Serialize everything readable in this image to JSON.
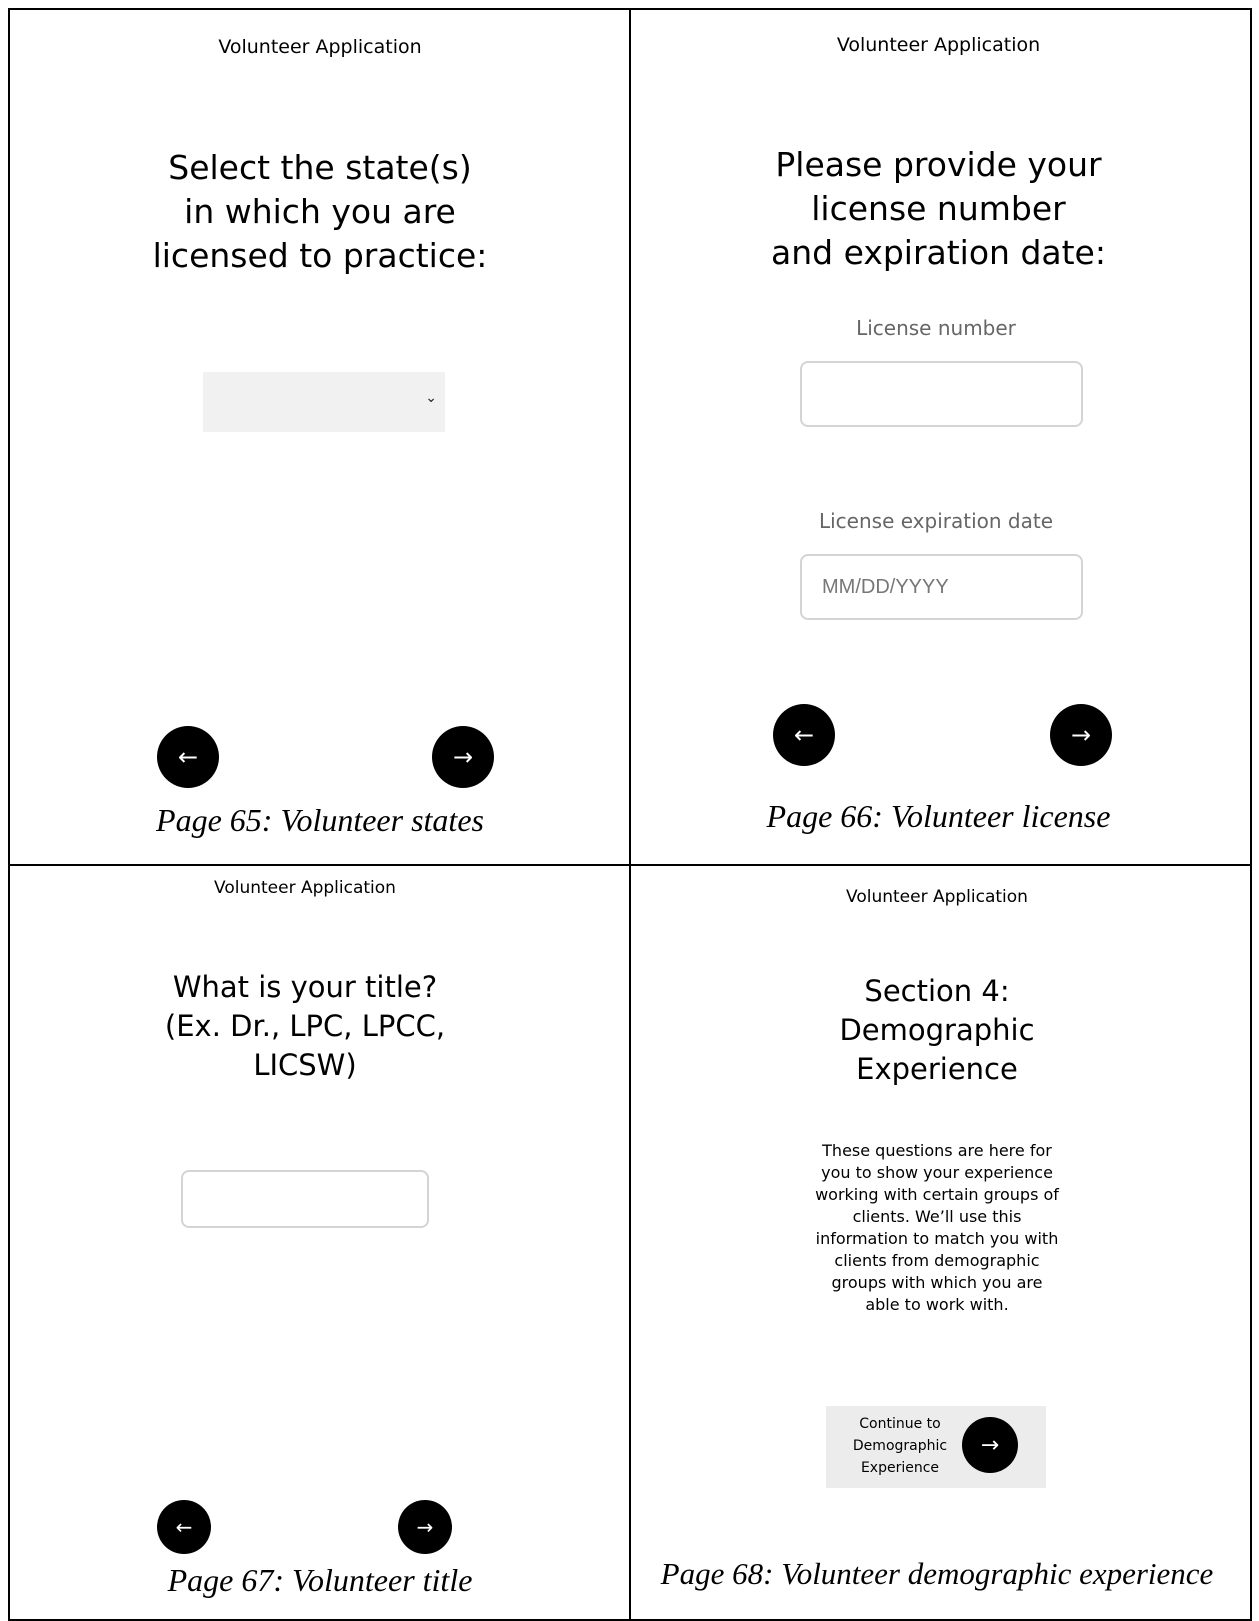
{
  "panels": [
    {
      "app_title": "Volunteer Application",
      "heading_lines": [
        "Select the state(s)",
        "in which you are",
        "licensed to practice:"
      ],
      "state_select": {
        "value": ""
      },
      "back_button": "←",
      "next_button": "→",
      "caption": "Page 65: Volunteer states"
    },
    {
      "app_title": "Volunteer Application",
      "heading_lines": [
        "Please provide your",
        "license number",
        "and expiration date:"
      ],
      "license_number_label": "License number",
      "license_number_value": "",
      "expiration_label": "License expiration date",
      "expiration_placeholder": "MM/DD/YYYY",
      "back_button": "←",
      "next_button": "→",
      "caption": "Page 66: Volunteer license"
    },
    {
      "app_title": "Volunteer Application",
      "heading_lines": [
        "What is your title?",
        "(Ex. Dr., LPC, LPCC,",
        "LICSW)"
      ],
      "title_value": "",
      "back_button": "←",
      "next_button": "→",
      "caption": "Page 67: Volunteer title"
    },
    {
      "app_title": "Volunteer Application",
      "heading_lines": [
        "Section 4:",
        "Demographic",
        "Experience"
      ],
      "body_lines": [
        "These questions are here for",
        "you to show your experience",
        "working with certain groups of",
        "clients. We’ll use this",
        "information to match you with",
        "clients from demographic",
        "groups with which you are",
        "able to work with."
      ],
      "continue_lines": [
        "Continue to",
        "Demographic",
        "Experience"
      ],
      "continue_button": "→",
      "caption": "Page 68: Volunteer demographic experience"
    }
  ]
}
